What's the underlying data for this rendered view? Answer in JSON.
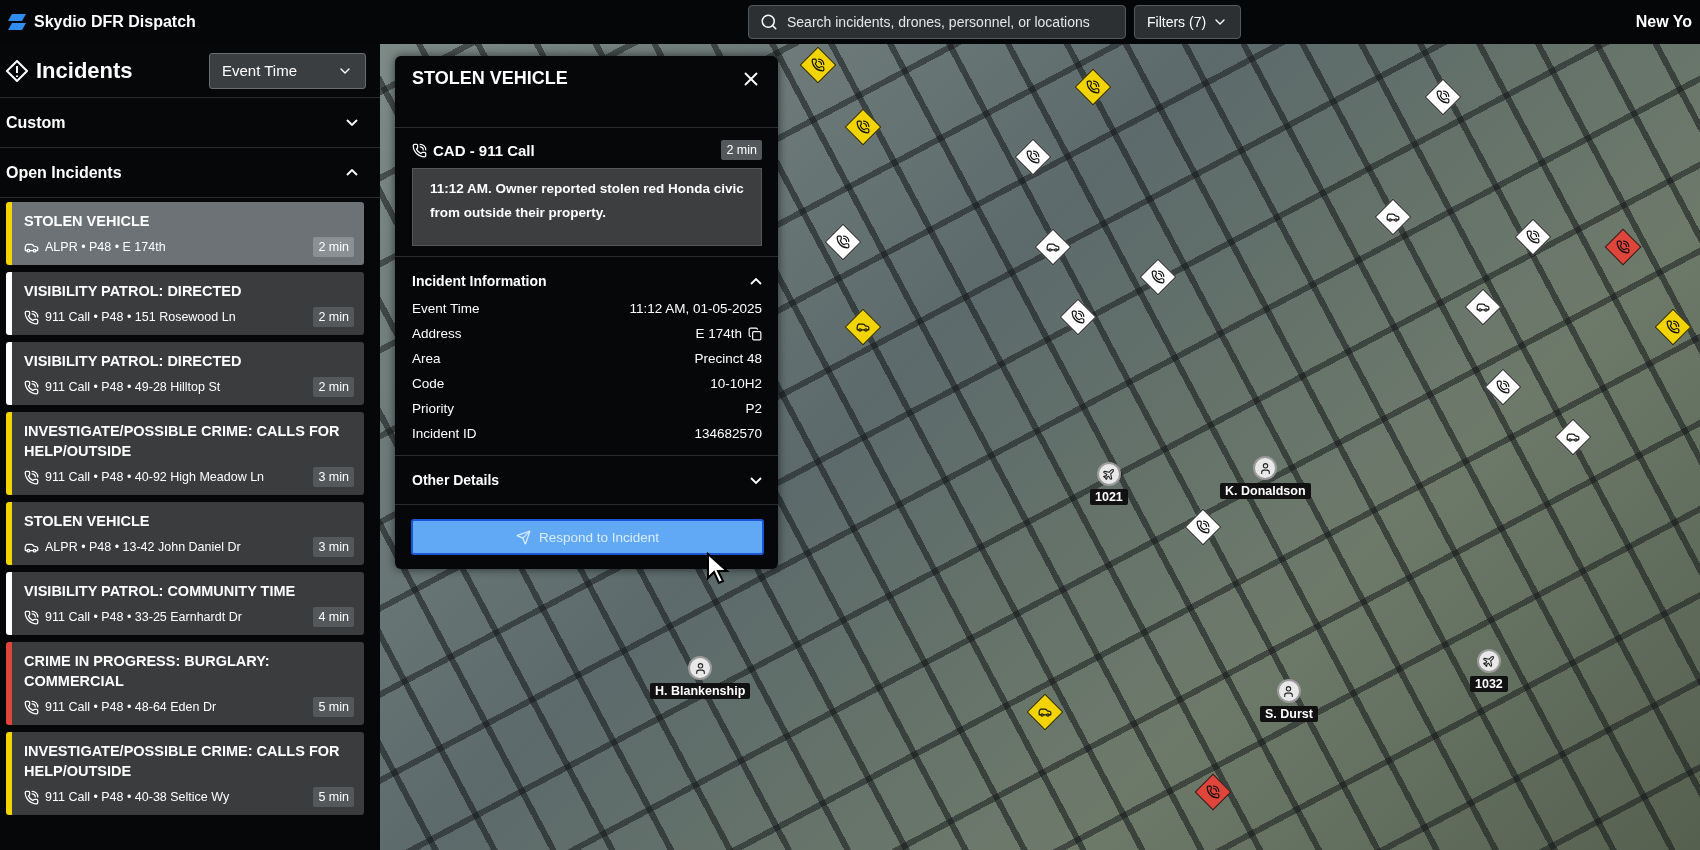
{
  "app": {
    "title": "Skydio DFR Dispatch",
    "search": {
      "placeholder": "Search incidents, drones, personnel, or locations"
    },
    "filters": "Filters (7)",
    "location": "New Yo"
  },
  "sidebar": {
    "title": "Incidents",
    "sort": "Event Time",
    "groups": [
      {
        "label": "Custom",
        "expanded": false
      },
      {
        "label": "Open Incidents",
        "expanded": true
      }
    ],
    "incidents": [
      {
        "title": "STOLEN VEHICLE",
        "kind": "alpr",
        "meta": "ALPR • P48 • E 174th",
        "age": "2 min",
        "color": "#f2d500",
        "selected": true
      },
      {
        "title": "VISIBILITY PATROL: DIRECTED",
        "kind": "call",
        "meta": "911 Call • P48 • 151 Rosewood Ln",
        "age": "2 min",
        "color": "#ffffff",
        "selected": false
      },
      {
        "title": "VISIBILITY PATROL: DIRECTED",
        "kind": "call",
        "meta": "911 Call • P48 • 49-28 Hilltop St",
        "age": "2 min",
        "color": "#ffffff",
        "selected": false
      },
      {
        "title": "INVESTIGATE/POSSIBLE CRIME: CALLS FOR HELP/OUTSIDE",
        "kind": "call",
        "meta": "911 Call • P48 • 40-92 High Meadow Ln",
        "age": "3 min",
        "color": "#f2d500",
        "selected": false
      },
      {
        "title": "STOLEN VEHICLE",
        "kind": "alpr",
        "meta": "ALPR • P48 • 13-42 John Daniel Dr",
        "age": "3 min",
        "color": "#f2d500",
        "selected": false
      },
      {
        "title": "VISIBILITY PATROL: COMMUNITY TIME",
        "kind": "call",
        "meta": "911 Call • P48 • 33-25 Earnhardt Dr",
        "age": "4 min",
        "color": "#ffffff",
        "selected": false
      },
      {
        "title": "CRIME IN PROGRESS: BURGLARY: COMMERCIAL",
        "kind": "call",
        "meta": "911 Call • P48 • 48-64 Eden Dr",
        "age": "5 min",
        "color": "#e0453a",
        "selected": false
      },
      {
        "title": "INVESTIGATE/POSSIBLE CRIME: CALLS FOR HELP/OUTSIDE",
        "kind": "call",
        "meta": "911 Call • P48 • 40-38 Seltice Wy",
        "age": "5 min",
        "color": "#f2d500",
        "selected": false
      }
    ]
  },
  "detail": {
    "title": "STOLEN VEHICLE",
    "source": "CAD - 911 Call",
    "age": "2 min",
    "note": "11:12 AM. Owner reported stolen red Honda civic from outside their property.",
    "info": {
      "label": "Incident Information",
      "expanded": true,
      "rows": [
        {
          "label": "Event Time",
          "value": "11:12 AM, 01-05-2025"
        },
        {
          "label": "Address",
          "value": "E 174th",
          "kind": "copy"
        },
        {
          "label": "Area",
          "value": "Precinct 48"
        },
        {
          "label": "Code",
          "value": "10-10H2"
        },
        {
          "label": "Priority",
          "value": "P2"
        },
        {
          "label": "Incident ID",
          "value": "134682570"
        }
      ]
    },
    "other": {
      "label": "Other Details",
      "expanded": false
    },
    "action": "Respond to Incident"
  },
  "map": {
    "markers": [
      {
        "kind": "call",
        "color": "#f2d500"
      },
      {
        "kind": "call",
        "color": "#f2d500"
      },
      {
        "kind": "call",
        "color": "#f2d500"
      },
      {
        "kind": "call",
        "color": "#ffffff"
      },
      {
        "kind": "call",
        "color": "#ffffff"
      },
      {
        "kind": "alpr",
        "color": "#ffffff"
      },
      {
        "kind": "alpr",
        "color": "#f2d500"
      },
      {
        "kind": "call",
        "color": "#ffffff"
      },
      {
        "kind": "call",
        "color": "#ffffff"
      },
      {
        "kind": "call",
        "color": "#ffffff"
      },
      {
        "kind": "alpr",
        "color": "#ffffff"
      },
      {
        "kind": "call",
        "color": "#e0453a"
      },
      {
        "kind": "call",
        "color": "#f2d500"
      },
      {
        "kind": "alpr",
        "color": "#ffffff"
      },
      {
        "kind": "call",
        "color": "#ffffff"
      },
      {
        "kind": "call",
        "color": "#ffffff"
      },
      {
        "kind": "alpr",
        "color": "#f2d500"
      },
      {
        "kind": "call",
        "color": "#e0453a"
      },
      {
        "kind": "call",
        "color": "#ffffff"
      },
      {
        "kind": "alpr",
        "color": "#ffffff"
      }
    ],
    "units": [
      {
        "label": "1021",
        "kind": "drone"
      },
      {
        "label": "K. Donaldson",
        "kind": "officer"
      },
      {
        "label": "H. Blankenship",
        "kind": "officer"
      },
      {
        "label": "S. Durst",
        "kind": "officer"
      },
      {
        "label": "1032",
        "kind": "drone"
      }
    ]
  }
}
